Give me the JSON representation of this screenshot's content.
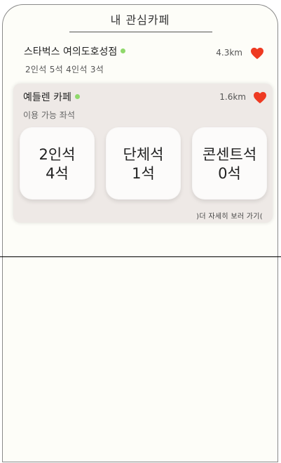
{
  "header": {
    "title": "내 관심카페"
  },
  "cafes": [
    {
      "name": "스타벅스 여의도호성점",
      "seats_summary": "2인석 5석 4인석 3석",
      "distance": "4.3km",
      "status_color": "#8fd86b"
    },
    {
      "name": "예들렌 카페",
      "subtitle": "이용 가능 좌석",
      "distance": "1.6km",
      "status_color": "#8fd86b",
      "seat_types": [
        {
          "label": "2인석",
          "count": "4석"
        },
        {
          "label": "단체석",
          "count": "1석"
        },
        {
          "label": "콘센트석",
          "count": "0석"
        }
      ],
      "more_link": ")더 자세히 보러 가기("
    }
  ],
  "colors": {
    "heart": "#ee3a22",
    "status_dot": "#8fd86b",
    "card_bg": "#eee9e6"
  },
  "icons": {
    "favorite": "heart-icon"
  }
}
